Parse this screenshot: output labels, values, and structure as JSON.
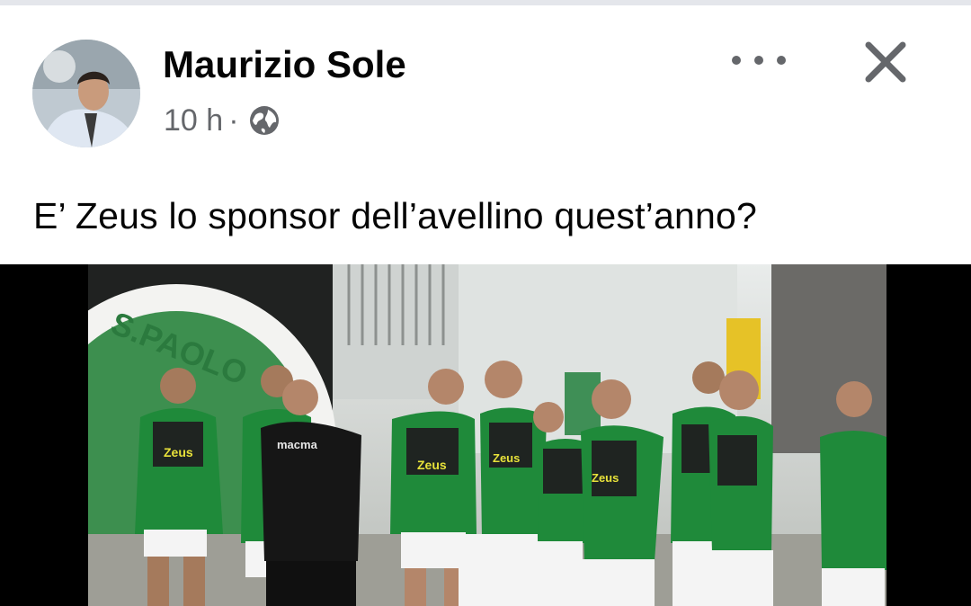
{
  "post": {
    "author": "Maurizio Sole",
    "time": "10 h",
    "separator": "·",
    "audience_icon": "globe-icon",
    "text": "E’ Zeus lo sponsor dell’avellino quest’anno?"
  },
  "header_actions": {
    "more_icon": "more-icon",
    "close_icon": "close-icon"
  },
  "photo": {
    "jersey_sponsor": "Zeus",
    "crest_text": "S.PAOLO",
    "back_print": "macma",
    "player_count": 11
  },
  "colors": {
    "text_primary": "#050505",
    "text_secondary": "#65676b",
    "divider": "#e4e6eb",
    "jersey_green": "#1f8a3a"
  }
}
